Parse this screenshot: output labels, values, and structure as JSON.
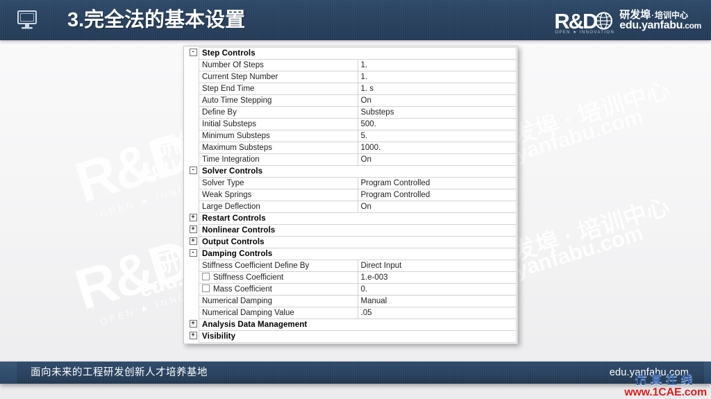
{
  "header": {
    "title": "3.完全法的基本设置",
    "icon": "monitor-icon",
    "bg_color": "#27405d"
  },
  "brand": {
    "mark_text": "R&D",
    "tagline": "OPEN ★ INNOVATION",
    "name_cn": "研发埠",
    "separator": "·",
    "sub_cn": "培训中心",
    "url_main": "edu.yanfabu",
    "url_tld": ".com"
  },
  "watermarks": {
    "logo_text": "R&D",
    "logo_tagline": "OPEN ★ INNOVATION",
    "cn_text": "研发埠 · 培训中心",
    "url_text": "edu.yanfabu.com"
  },
  "property_grid": {
    "rows": [
      {
        "type": "group",
        "toggle": "-",
        "label": "Step Controls"
      },
      {
        "type": "prop",
        "label": "Number Of Steps",
        "value": "1."
      },
      {
        "type": "prop",
        "label": "Current Step Number",
        "value": "1."
      },
      {
        "type": "prop",
        "label": "Step End Time",
        "value": "1. s"
      },
      {
        "type": "prop",
        "label": "Auto Time Stepping",
        "value": "On"
      },
      {
        "type": "prop",
        "label": "Define By",
        "value": "Substeps"
      },
      {
        "type": "prop",
        "label": "Initial Substeps",
        "value": "500."
      },
      {
        "type": "prop",
        "label": "Minimum Substeps",
        "value": "5."
      },
      {
        "type": "prop",
        "label": "Maximum Substeps",
        "value": "1000."
      },
      {
        "type": "prop",
        "label": "Time Integration",
        "value": "On"
      },
      {
        "type": "group",
        "toggle": "-",
        "label": "Solver Controls"
      },
      {
        "type": "prop",
        "label": "Solver Type",
        "value": "Program Controlled"
      },
      {
        "type": "prop",
        "label": "Weak Springs",
        "value": "Program Controlled"
      },
      {
        "type": "prop",
        "label": "Large Deflection",
        "value": "On"
      },
      {
        "type": "group",
        "toggle": "+",
        "label": "Restart Controls"
      },
      {
        "type": "group",
        "toggle": "+",
        "label": "Nonlinear Controls"
      },
      {
        "type": "group",
        "toggle": "+",
        "label": "Output Controls"
      },
      {
        "type": "group",
        "toggle": "-",
        "label": "Damping Controls"
      },
      {
        "type": "prop",
        "label": "Stiffness Coefficient Define By",
        "value": "Direct Input"
      },
      {
        "type": "prop",
        "label": "Stiffness Coefficient",
        "value": "1.e-003",
        "checkbox": true,
        "checked": false
      },
      {
        "type": "prop",
        "label": "Mass Coefficient",
        "value": "0.",
        "checkbox": true,
        "checked": false
      },
      {
        "type": "prop",
        "label": "Numerical Damping",
        "value": "Manual"
      },
      {
        "type": "prop",
        "label": "Numerical Damping Value",
        "value": ".05"
      },
      {
        "type": "group",
        "toggle": "+",
        "label": "Analysis Data Management"
      },
      {
        "type": "group",
        "toggle": "+",
        "label": "Visibility"
      }
    ]
  },
  "footer": {
    "left_text": "面向未来的工程研发创新人才培养基地",
    "right_text": "edu.yanfabu.com"
  },
  "corner_watermark": {
    "cn": "仿真在线",
    "url": "www.1CAE.com",
    "cn_color": "#2f5fa8",
    "url_color": "#e01f1f"
  }
}
